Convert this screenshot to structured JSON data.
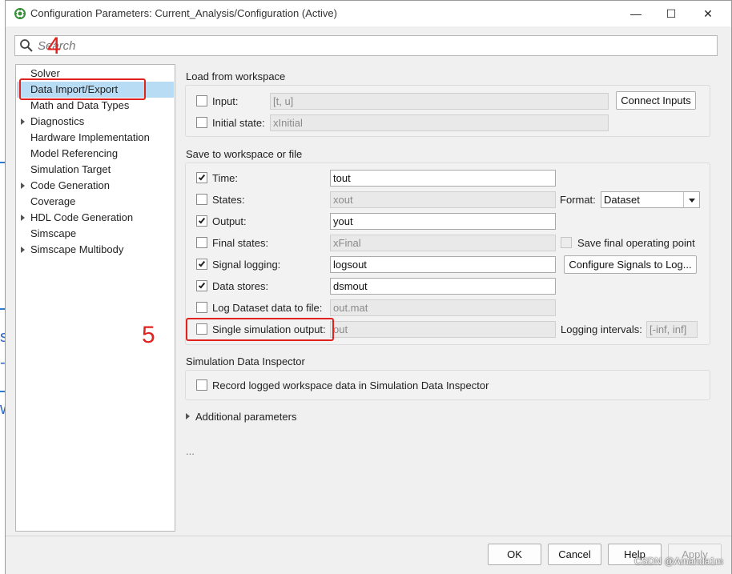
{
  "window": {
    "title": "Configuration Parameters: Current_Analysis/Configuration (Active)",
    "minimize_glyph": "—",
    "maximize_glyph": "☐",
    "close_glyph": "✕"
  },
  "search": {
    "placeholder": "Search"
  },
  "tree": {
    "items": [
      {
        "label": "Solver",
        "expandable": false
      },
      {
        "label": "Data Import/Export",
        "expandable": false,
        "selected": true
      },
      {
        "label": "Math and Data Types",
        "expandable": false
      },
      {
        "label": "Diagnostics",
        "expandable": true
      },
      {
        "label": "Hardware Implementation",
        "expandable": false
      },
      {
        "label": "Model Referencing",
        "expandable": false
      },
      {
        "label": "Simulation Target",
        "expandable": false
      },
      {
        "label": "Code Generation",
        "expandable": true
      },
      {
        "label": "Coverage",
        "expandable": false
      },
      {
        "label": "HDL Code Generation",
        "expandable": true
      },
      {
        "label": "Simscape",
        "expandable": false
      },
      {
        "label": "Simscape Multibody",
        "expandable": true
      }
    ]
  },
  "load": {
    "title": "Load from workspace",
    "input_label": "Input:",
    "input_value": "[t, u]",
    "input_checked": false,
    "connect_inputs": "Connect Inputs",
    "initial_label": "Initial state:",
    "initial_value": "xInitial",
    "initial_checked": false
  },
  "save": {
    "title": "Save to workspace or file",
    "time_label": "Time:",
    "time_value": "tout",
    "time_checked": true,
    "states_label": "States:",
    "states_value": "xout",
    "states_checked": false,
    "format_label": "Format:",
    "format_value": "Dataset",
    "output_label": "Output:",
    "output_value": "yout",
    "output_checked": true,
    "final_label": "Final states:",
    "final_value": "xFinal",
    "final_checked": false,
    "save_final_label": "Save final operating point",
    "save_final_checked": false,
    "siglog_label": "Signal logging:",
    "siglog_value": "logsout",
    "siglog_checked": true,
    "config_signals": "Configure Signals to Log...",
    "datastores_label": "Data stores:",
    "datastores_value": "dsmout",
    "datastores_checked": true,
    "logfile_label": "Log Dataset data to file:",
    "logfile_value": "out.mat",
    "logfile_checked": false,
    "single_label": "Single simulation output:",
    "single_value": "out",
    "single_checked": false,
    "intervals_label": "Logging intervals:",
    "intervals_value": "[-inf, inf]"
  },
  "sdi": {
    "title": "Simulation Data Inspector",
    "record_label": "Record logged workspace data in Simulation Data Inspector",
    "record_checked": false
  },
  "additional": {
    "label": "Additional parameters",
    "ellipsis": "..."
  },
  "footer": {
    "ok": "OK",
    "cancel": "Cancel",
    "help": "Help",
    "apply": "Apply"
  },
  "annotations": {
    "step4": "4",
    "step5": "5",
    "watermark": "CSDN @Amanda1m"
  },
  "colors": {
    "highlight_red": "#e0231f",
    "selection_blue": "#b9dcf5",
    "app_icon_green": "#3a8f3a"
  }
}
